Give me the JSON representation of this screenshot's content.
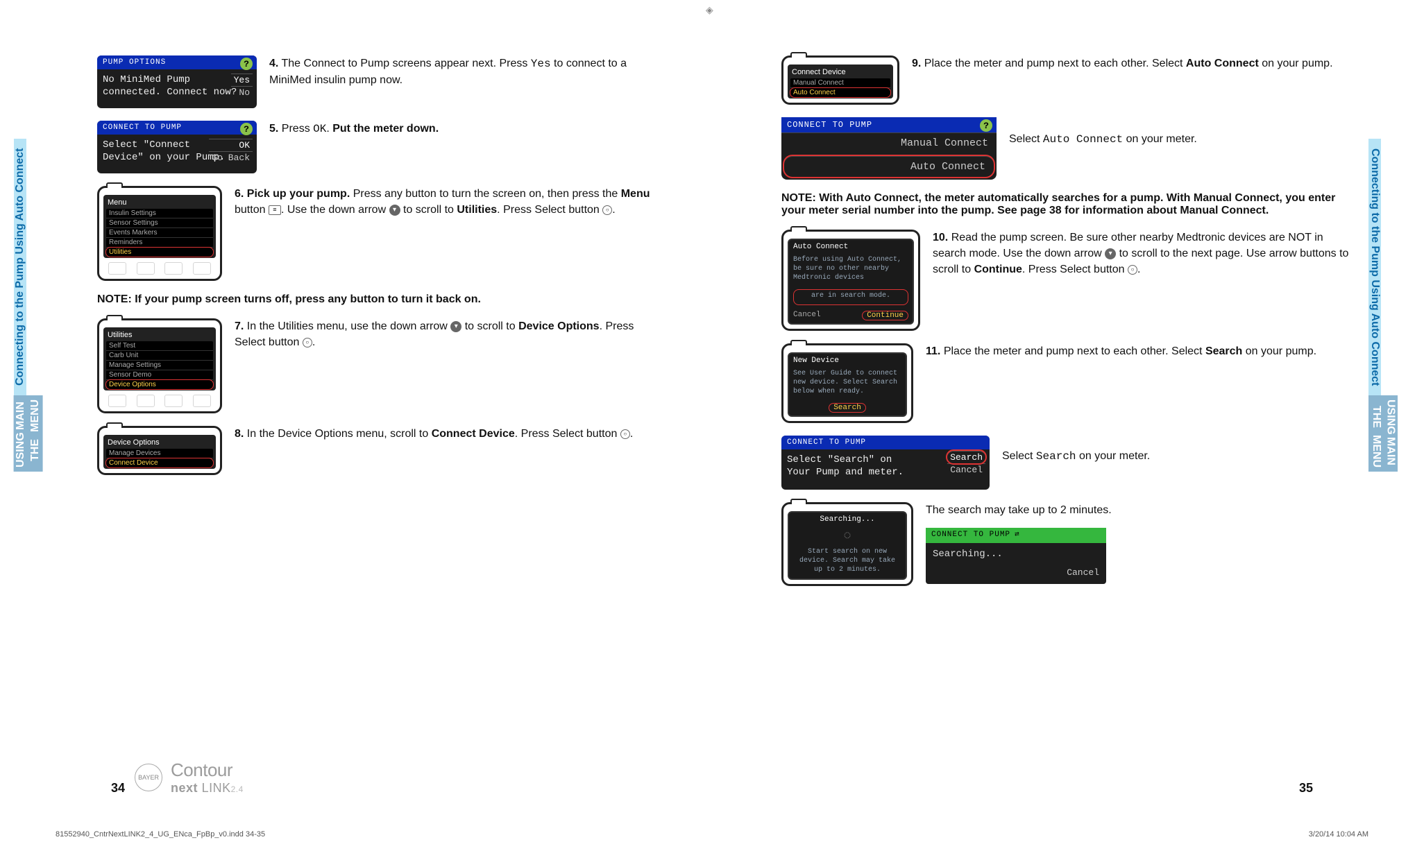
{
  "tabs": {
    "upper": "Connecting to the Pump Using Auto Connect",
    "lower_line1": "USING THE",
    "lower_line2": "MAIN MENU"
  },
  "left": {
    "meter4": {
      "header": "PUMP OPTIONS",
      "line1": "No MiniMed Pump",
      "line2": "connected. Connect now?",
      "opt_yes": "Yes",
      "opt_no": "No"
    },
    "step4": {
      "num": "4.",
      "text_a": "The Connect to Pump screens appear next. Press ",
      "code": "Yes",
      "text_b": " to connect to a MiniMed insulin pump now."
    },
    "meter5": {
      "header": "CONNECT TO PUMP",
      "line1": "Select \"Connect",
      "line2": "Device\" on your Pump.",
      "opt_ok": "OK",
      "opt_back": "Go Back"
    },
    "step5": {
      "num": "5.",
      "text_a": "Press ",
      "code": "OK",
      "text_b": ". ",
      "bold": "Put the meter down."
    },
    "pump6": {
      "title": "Menu",
      "items": [
        "Insulin Settings",
        "Sensor Settings",
        "Events Markers",
        "Reminders",
        "Utilities"
      ]
    },
    "step6": {
      "num": "6.",
      "bold_lead": "Pick up your pump.",
      "text_a": " Press any button to turn the screen on, then press the ",
      "bold_menu": "Menu",
      "text_b": " button ",
      "text_c": ". Use the down arrow ",
      "text_d": " to scroll to ",
      "bold_util": "Utilities",
      "text_e": ". Press Select button ",
      "text_f": "."
    },
    "note6": "NOTE: If your pump screen turns off, press any button to turn it back on.",
    "pump7": {
      "title": "Utilities",
      "items": [
        "Self Test",
        "Carb Unit",
        "Manage Settings",
        "Sensor Demo",
        "Device Options"
      ]
    },
    "step7": {
      "num": "7.",
      "text_a": "In the Utilities menu, use the down arrow ",
      "text_b": " to scroll to ",
      "bold": "Device Options",
      "text_c": ". Press Select button ",
      "text_d": "."
    },
    "pump8": {
      "title": "Device Options",
      "items": [
        "Manage Devices",
        "Connect Device"
      ]
    },
    "step8": {
      "num": "8.",
      "text_a": "In the Device Options menu, scroll to ",
      "bold": "Connect Device",
      "text_b": ". Press Select button ",
      "text_c": "."
    },
    "page_num": "34",
    "logo_top": "Contour",
    "logo_bot": "next",
    "logo_link": "LINK",
    "logo_24": "2.4"
  },
  "right": {
    "pump9": {
      "title": "Connect Device",
      "items": [
        "Manual Connect",
        "Auto Connect"
      ]
    },
    "step9": {
      "num": "9.",
      "text_a": "Place the meter and pump next to each other. Select ",
      "bold": "Auto Connect",
      "text_b": " on your pump."
    },
    "meter9b": {
      "header": "CONNECT TO PUMP",
      "opt1": "Manual Connect",
      "opt2": "Auto Connect"
    },
    "step9b": {
      "text_a": "Select ",
      "code": "Auto Connect",
      "text_b": " on your meter."
    },
    "note9": "NOTE: With Auto Connect, the meter automatically searches for a pump. With Manual Connect, you enter your meter serial number into the pump. See page 38 for information about Manual Connect.",
    "pump10": {
      "title": "Auto Connect",
      "body": "Before using Auto Connect, be sure no other nearby Medtronic devices",
      "body2": "are in search mode.",
      "btn_cancel": "Cancel",
      "btn_cont": "Continue"
    },
    "step10": {
      "num": "10.",
      "text_a": "Read the pump screen. Be sure other nearby Medtronic devices are NOT in search mode. Use the down arrow ",
      "text_b": " to scroll to the next page. Use arrow buttons to scroll to ",
      "bold": "Continue",
      "text_c": ". Press Select button ",
      "text_d": "."
    },
    "pump11": {
      "title": "New Device",
      "body": "See User Guide to connect new device. Select Search below when ready.",
      "btn": "Search"
    },
    "step11": {
      "num": "11.",
      "text_a": "Place the meter and pump next to each other. Select ",
      "bold": "Search",
      "text_b": " on your pump."
    },
    "meter11b": {
      "header": "CONNECT TO PUMP",
      "line1": "Select \"Search\" on",
      "line2": "Your Pump and meter.",
      "opt1": "Search",
      "opt2": "Cancel"
    },
    "step11b": {
      "text_a": "Select ",
      "code": "Search",
      "text_b": " on your meter."
    },
    "pump12": {
      "title": "Searching...",
      "body": "Start search on new device. Search may take up to 2 minutes."
    },
    "step12a": "The search may take up to 2 minutes.",
    "meter12": {
      "header": "CONNECT TO PUMP",
      "body": "Searching...",
      "cancel": "Cancel"
    },
    "page_num": "35"
  },
  "slug": {
    "file": "81552940_CntrNextLINK2_4_UG_ENca_FpBp_v0.indd   34-35",
    "stamp": "3/20/14   10:04 AM"
  }
}
